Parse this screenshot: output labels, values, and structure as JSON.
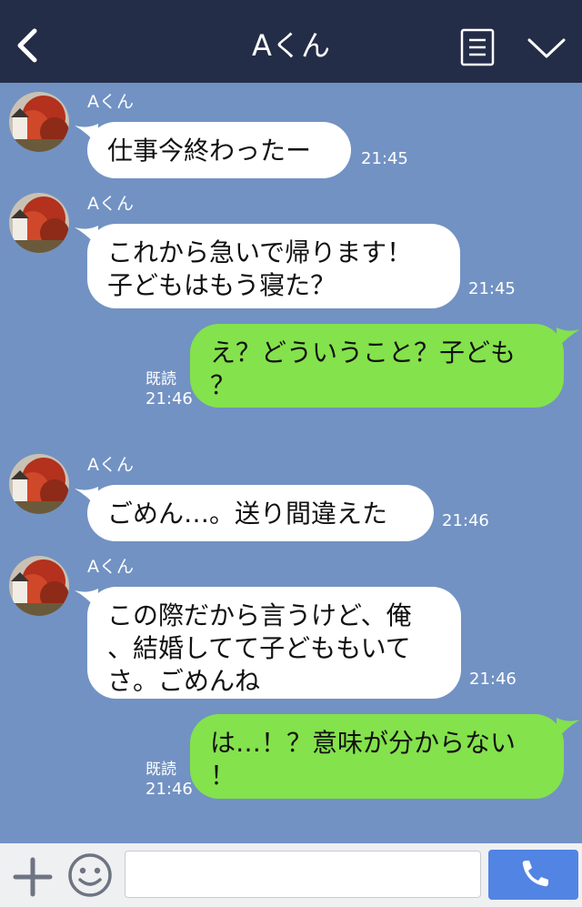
{
  "header": {
    "title": "Aくん"
  },
  "colors": {
    "header_bg": "#232d47",
    "chat_bg": "#7292c3",
    "incoming_bubble": "#ffffff",
    "outgoing_bubble": "#84e24c",
    "send_button": "#5284e3"
  },
  "messages": [
    {
      "direction": "incoming",
      "sender": "Aくん",
      "lines": [
        "仕事今終わったー"
      ],
      "time": "21:45"
    },
    {
      "direction": "incoming",
      "sender": "Aくん",
      "lines": [
        "これから急いで帰ります！",
        "子どもはもう寝た？"
      ],
      "time": "21:45"
    },
    {
      "direction": "outgoing",
      "lines": [
        "え？どういうこと？子ども",
        "？"
      ],
      "read_label": "既読",
      "time": "21:46"
    },
    {
      "direction": "incoming",
      "sender": "Aくん",
      "lines": [
        "ごめん…。送り間違えた"
      ],
      "time": "21:46"
    },
    {
      "direction": "incoming",
      "sender": "Aくん",
      "lines": [
        "この際だから言うけど、俺",
        "、結婚してて子どももいて",
        "さ。ごめんね"
      ],
      "time": "21:46"
    },
    {
      "direction": "outgoing",
      "lines": [
        "は…！？意味が分からない",
        "！"
      ],
      "read_label": "既読",
      "time": "21:46"
    }
  ],
  "input": {
    "placeholder": "",
    "value": ""
  },
  "icons": {
    "back": "chevron-left-icon",
    "notes": "notes-icon",
    "menu": "chevron-down-icon",
    "add": "plus-icon",
    "emoji": "smiley-icon",
    "call": "phone-icon"
  }
}
